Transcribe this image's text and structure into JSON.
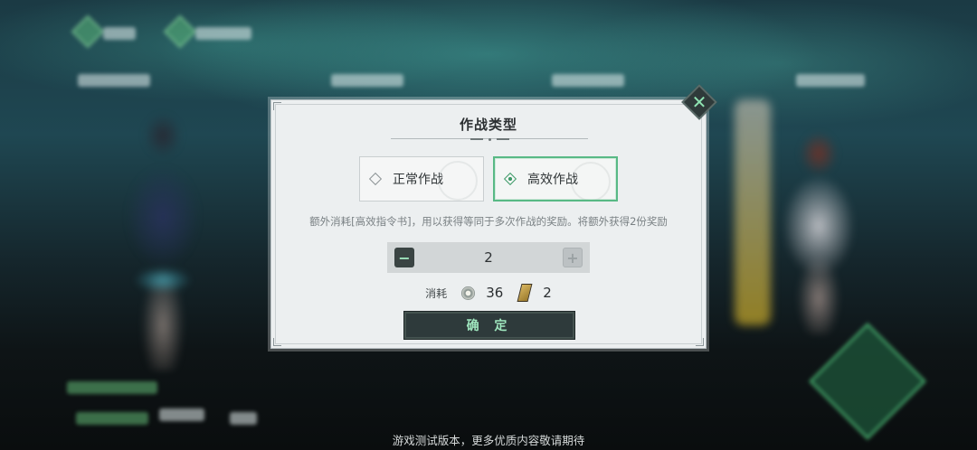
{
  "dialog": {
    "title": "作战类型",
    "close_icon": "close-x",
    "modes": [
      {
        "label": "正常作战",
        "selected": false
      },
      {
        "label": "高效作战",
        "selected": true
      }
    ],
    "description": "额外消耗[高效指令书]，用以获得等同于多次作战的奖励。将额外获得2份奖励",
    "stepper": {
      "minus": "−",
      "value": "2",
      "plus": "+"
    },
    "cost": {
      "label": "消耗",
      "items": [
        {
          "icon": "coin-icon",
          "amount": "36"
        },
        {
          "icon": "ticket-icon",
          "amount": "2"
        }
      ]
    },
    "confirm_label": "确 定"
  },
  "footer": "游戏测试版本，更多优质内容敬请期待",
  "colors": {
    "accent_green": "#58b985",
    "confirm_bg": "#2e3a3b",
    "dialog_bg": "#eceff0"
  }
}
